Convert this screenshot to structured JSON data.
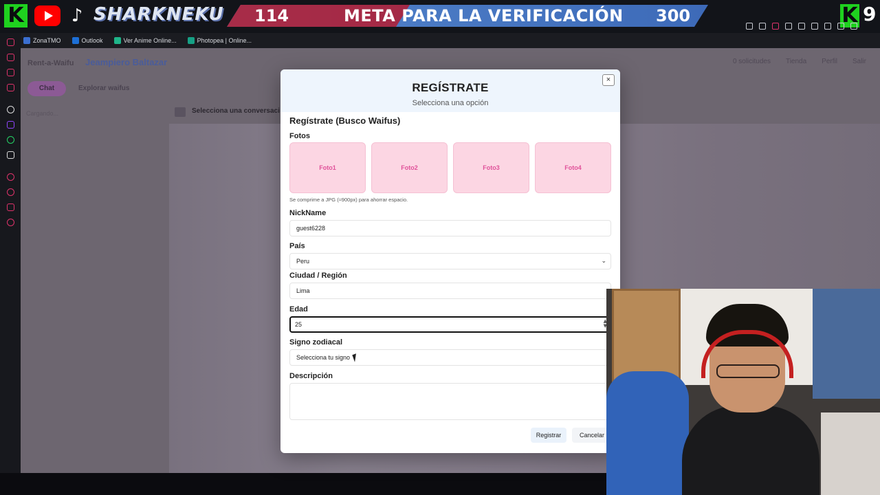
{
  "stream_overlay": {
    "brand": "SHARKNEKU",
    "goal_current": "114",
    "goal_text": "META PARA LA VERIFICACIÓN",
    "goal_target": "300",
    "goal_progress": 0.38,
    "k_badge_count": "9",
    "colors": {
      "k_green": "#1fd11f",
      "goal_blue": "#4a7ac4",
      "goal_red": "#b41b2f"
    }
  },
  "browser": {
    "bookmarks": [
      {
        "label": "ZonaTMO",
        "color": "#3b6fd1"
      },
      {
        "label": "Outlook",
        "color": "#1d6fd6"
      },
      {
        "label": "Ver Anime Online...",
        "color": "#1fb58a"
      },
      {
        "label": "Photopea | Online...",
        "color": "#16a085"
      }
    ]
  },
  "app": {
    "name": "Rent-a-Waifu",
    "user": "Jeampiero Baltazar",
    "nav": [
      "0 solicitudes",
      "Tienda",
      "Perfil",
      "Salir"
    ],
    "chat_tab": "Chat",
    "explore_tab": "Explorar waifus",
    "loading": "Cargando...",
    "conversation_hint": "Selecciona una conversaci"
  },
  "modal": {
    "title": "REGÍSTRATE",
    "subtitle": "Selecciona una opción",
    "section": "Regístrate (Busco Waifus)",
    "photos_label": "Fotos",
    "photos": [
      "Foto1",
      "Foto2",
      "Foto3",
      "Foto4"
    ],
    "photos_hint": "Se comprime a JPG (≈900px) para ahorrar espacio.",
    "nickname_label": "NickName",
    "nickname_value": "guest6228",
    "country_label": "País",
    "country_value": "Peru",
    "city_label": "Ciudad / Región",
    "city_value": "Lima",
    "age_label": "Edad",
    "age_value": "25",
    "zodiac_label": "Signo zodiacal",
    "zodiac_value": "Selecciona tu signo",
    "description_label": "Descripción",
    "register_button": "Registrar",
    "cancel_button": "Cancelar",
    "close_icon": "×"
  }
}
